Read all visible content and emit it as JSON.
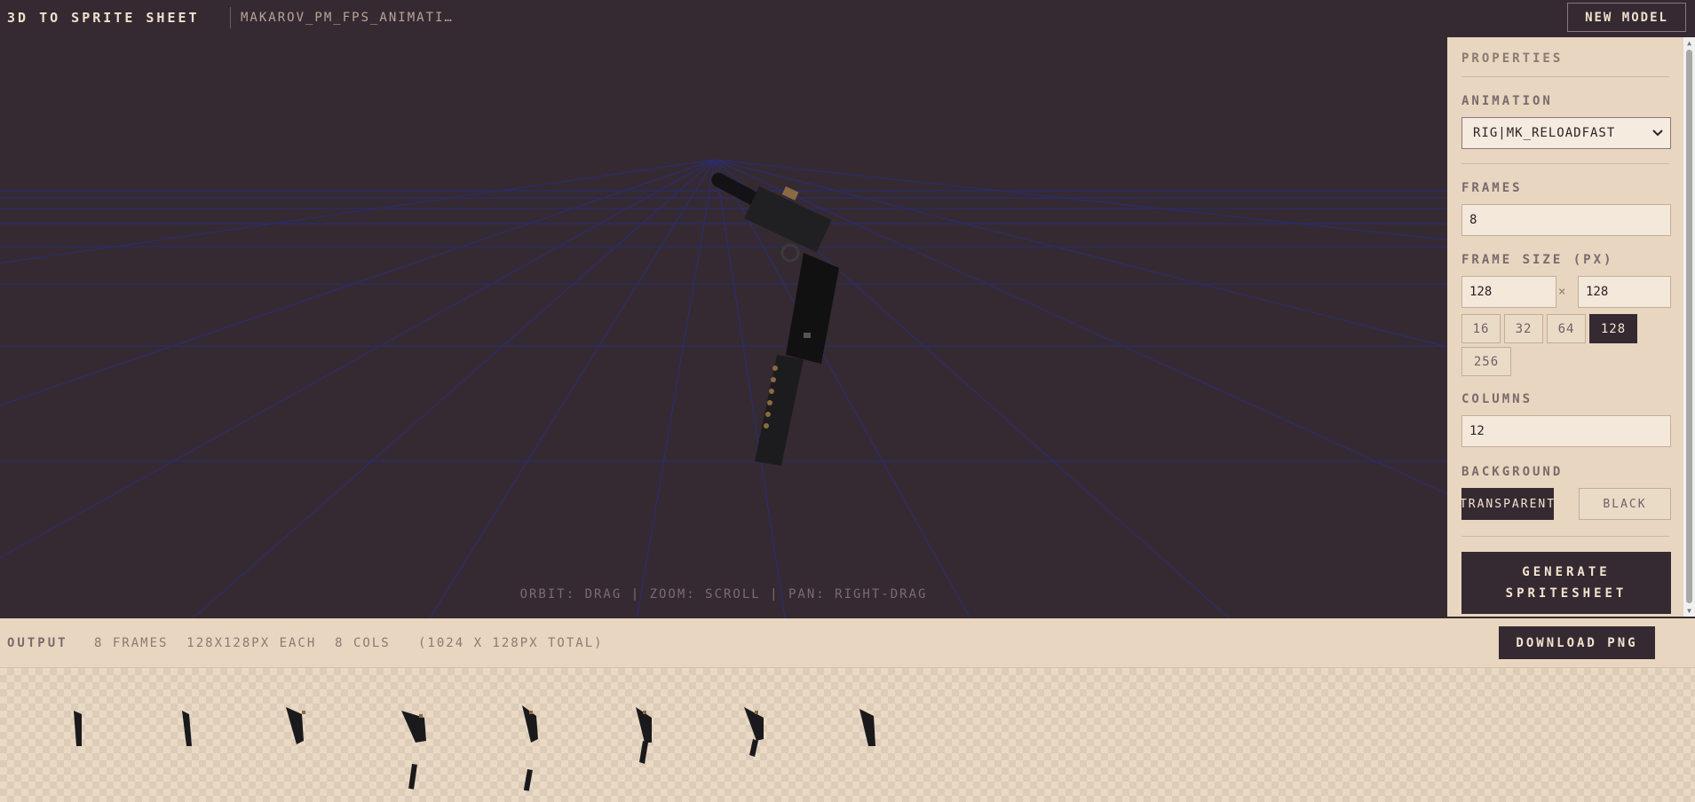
{
  "header": {
    "app_title": "3D TO SPRITE SHEET",
    "model_name": "MAKAROV_PM_FPS_ANIMATI…",
    "new_model_label": "NEW MODEL"
  },
  "viewport": {
    "hint": "ORBIT: DRAG  |  ZOOM: SCROLL  |  PAN: RIGHT-DRAG"
  },
  "properties": {
    "heading": "PROPERTIES",
    "animation": {
      "label": "ANIMATION",
      "selected": "RIG|MK_RELOADFAST"
    },
    "frames": {
      "label": "FRAMES",
      "value": "8"
    },
    "frame_size": {
      "label": "FRAME SIZE (PX)",
      "width": "128",
      "height": "128",
      "separator": "×",
      "presets": [
        "16",
        "32",
        "64",
        "128",
        "256"
      ],
      "active_preset": "128"
    },
    "columns": {
      "label": "COLUMNS",
      "value": "12"
    },
    "background": {
      "label": "BACKGROUND",
      "options": [
        "TRANSPARENT",
        "BLACK"
      ],
      "active": "TRANSPARENT"
    },
    "generate_label_line1": "GENERATE",
    "generate_label_line2": "SPRITESHEET"
  },
  "output": {
    "label": "OUTPUT",
    "info": "8 FRAMES  128X128PX EACH  8 COLS   (1024 X 128PX TOTAL)",
    "download_label": "DOWNLOAD PNG",
    "frame_count": 8
  },
  "colors": {
    "dark": "#352a31",
    "panel": "#e8d6c0",
    "grid": "#2e2f6e"
  }
}
